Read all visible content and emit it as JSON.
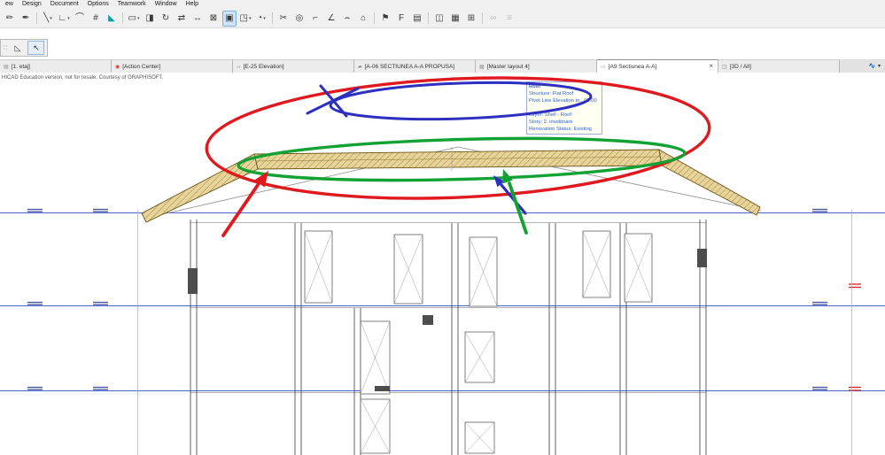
{
  "menu": {
    "items": [
      "ew",
      "Design",
      "Document",
      "Options",
      "Teamwork",
      "Window",
      "Help"
    ]
  },
  "toolbar": {
    "dropdown_glyph": "▾",
    "items": [
      {
        "name": "brush-tool",
        "glyph": "✏"
      },
      {
        "name": "pen-tool",
        "glyph": "✒"
      },
      {
        "sep": true
      },
      {
        "name": "line-tool",
        "glyph": "╲",
        "dropdown": true
      },
      {
        "name": "polyline-tool",
        "glyph": "∟",
        "dropdown": true
      },
      {
        "name": "arc-tool",
        "glyph": "⌒"
      },
      {
        "name": "grid-snap-tool",
        "glyph": "#"
      },
      {
        "name": "gravity-tool",
        "glyph": "◣",
        "color": "#0aa0a8"
      },
      {
        "sep": true
      },
      {
        "name": "marquee-tool",
        "glyph": "▭",
        "dropdown": true
      },
      {
        "name": "lock-tool",
        "glyph": "◨"
      },
      {
        "name": "rotate-tool",
        "glyph": "↻"
      },
      {
        "name": "mirror-tool",
        "glyph": "⇄"
      },
      {
        "name": "move-tool",
        "glyph": "↔"
      },
      {
        "name": "trim-tool",
        "glyph": "⊠"
      },
      {
        "name": "selection-frame-tool",
        "glyph": "▣",
        "pressed": true
      },
      {
        "name": "morph-tool",
        "glyph": "◳",
        "dropdown": true
      },
      {
        "name": "circle-tool",
        "glyph": "◔",
        "dropdown": true
      },
      {
        "sep": true
      },
      {
        "name": "split-tool",
        "glyph": "✂"
      },
      {
        "name": "zoom-tool",
        "glyph": "◎"
      },
      {
        "name": "corner-tool",
        "glyph": "⌐"
      },
      {
        "name": "angle-tool",
        "glyph": "∠"
      },
      {
        "name": "fillet-tool",
        "glyph": "⌢"
      },
      {
        "name": "arch-tool",
        "glyph": "⌂"
      },
      {
        "sep": true
      },
      {
        "name": "flag-tool",
        "glyph": "⚑"
      },
      {
        "name": "label-tool",
        "glyph": "F"
      },
      {
        "name": "story-tool",
        "glyph": "▤"
      },
      {
        "sep": true
      },
      {
        "name": "window-tool",
        "glyph": "◫"
      },
      {
        "name": "layout-tool",
        "glyph": "▦"
      },
      {
        "name": "grid-tool",
        "glyph": "⊞"
      },
      {
        "sep": true
      },
      {
        "name": "link-tool",
        "glyph": "∞",
        "disabled": true
      },
      {
        "name": "options-tool",
        "glyph": "≡",
        "disabled": true
      }
    ]
  },
  "mini_toolbar": {
    "handle_glyph": "∷",
    "items": [
      {
        "name": "origin-tool",
        "glyph": "◺"
      },
      {
        "name": "arrow-tool",
        "glyph": "↖",
        "pressed": true
      }
    ]
  },
  "tab_bar": {
    "close_glyph": "×",
    "overflow_icon_glyph": "∿",
    "dropdown_glyph": "▾",
    "tabs": [
      {
        "label": "[1. etaj]",
        "icon": "▤",
        "icon_color": "#8a8a8a",
        "active": false
      },
      {
        "label": "[Action Center]",
        "icon": "◉",
        "icon_color": "#d43b2a",
        "active": false
      },
      {
        "label": "[E-25 Elevation]",
        "icon": "▱",
        "icon_color": "#8a8a8a",
        "active": false
      },
      {
        "label": "[A-06 SECTIUNEA A-A PROPUSA]",
        "icon": "▰",
        "icon_color": "#8a8a8a",
        "active": false
      },
      {
        "label": "[Master layout 4]",
        "icon": "▦",
        "icon_color": "#9a9a9a",
        "active": false
      },
      {
        "label": "[A9 Sectiunea A-A]",
        "icon": "▭",
        "icon_color": "#8a8a8a",
        "active": true
      },
      {
        "label": "[3D / All]",
        "icon": "◳",
        "icon_color": "#8a8a8a",
        "active": false
      }
    ]
  },
  "canvas": {
    "education_notice": "HICAD Education version, not for resale. Courtesy of GRAPHISOFT.",
    "tooltip": {
      "title": "Roof",
      "lines": [
        "Structure: Flat Roof",
        "Pivot Line Elevation to...00.00",
        "",
        "Layer: Shell - Roof",
        "Story: 2. invelitoare",
        "Renovation Status: Existing"
      ]
    }
  },
  "colors": {
    "annotation_red": "#e0191f",
    "annotation_green": "#12a233",
    "annotation_blue": "#2c2fc0",
    "story_line": "#4a63cf",
    "level_marker": "#3f4f9e",
    "elevation_tick_red": "#cc1f1f",
    "roof_fill": "#e7d49c",
    "tooltip_text": "#2a62d8"
  }
}
